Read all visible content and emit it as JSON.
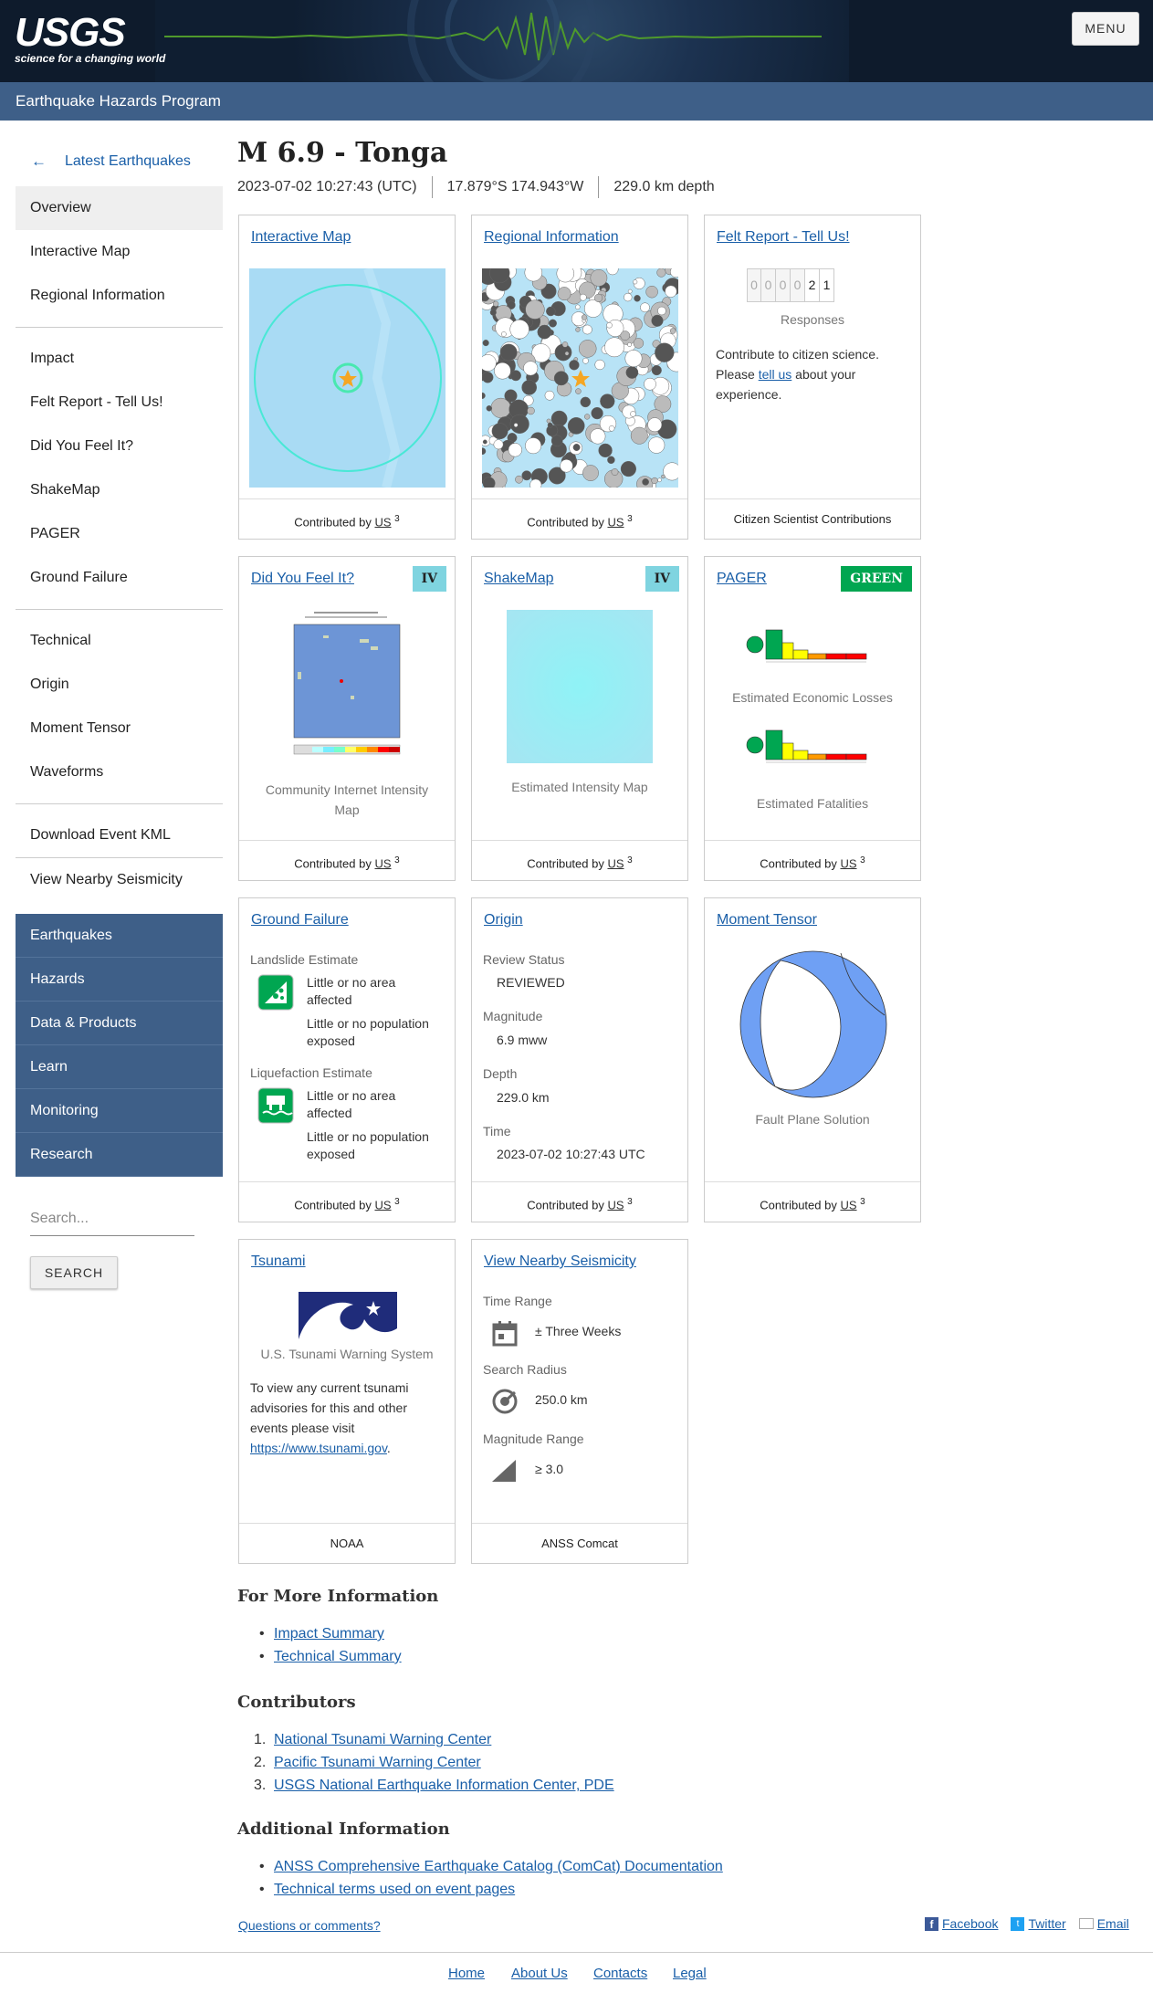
{
  "header": {
    "logo": "USGS",
    "tagline": "science for a changing world",
    "menu_label": "MENU",
    "program": "Earthquake Hazards Program"
  },
  "sidebar": {
    "back_label": "Latest Earthquakes",
    "groups": [
      [
        "Overview",
        "Interactive Map",
        "Regional Information"
      ],
      [
        "Impact",
        "Felt Report - Tell Us!",
        "Did You Feel It?",
        "ShakeMap",
        "PAGER",
        "Ground Failure"
      ],
      [
        "Technical",
        "Origin",
        "Moment Tensor",
        "Waveforms"
      ],
      [
        "Download Event KML"
      ],
      [
        "View Nearby Seismicity"
      ]
    ],
    "site_nav": [
      "Earthquakes",
      "Hazards",
      "Data & Products",
      "Learn",
      "Monitoring",
      "Research"
    ],
    "search_placeholder": "Search...",
    "search_button": "SEARCH"
  },
  "event": {
    "title": "M 6.9 - Tonga",
    "time": "2023-07-02 10:27:43 (UTC)",
    "location": "17.879°S 174.943°W",
    "depth": "229.0 km depth"
  },
  "cards": {
    "interactive_map": {
      "title": "Interactive Map",
      "footer": "Contributed by",
      "net": "US",
      "sup": "3"
    },
    "regional": {
      "title": "Regional Information",
      "footer": "Contributed by",
      "net": "US",
      "sup": "3"
    },
    "felt_report": {
      "title": "Felt Report - Tell Us!",
      "digits": [
        "0",
        "0",
        "0",
        "0",
        "2",
        "1"
      ],
      "responses_label": "Responses",
      "text_before": "Contribute to citizen science. Please ",
      "link": "tell us",
      "text_after": " about your experience.",
      "footer": "Citizen Scientist Contributions"
    },
    "dyfi": {
      "title": "Did You Feel It?",
      "badge": "IV",
      "caption": "Community Internet Intensity Map",
      "footer": "Contributed by",
      "net": "US",
      "sup": "3"
    },
    "shakemap": {
      "title": "ShakeMap",
      "badge": "IV",
      "caption": "Estimated Intensity Map",
      "footer": "Contributed by",
      "net": "US",
      "sup": "3"
    },
    "pager": {
      "title": "PAGER",
      "badge": "GREEN",
      "economic": "Estimated Economic Losses",
      "fatalities": "Estimated Fatalities",
      "footer": "Contributed by",
      "net": "US",
      "sup": "3"
    },
    "ground_failure": {
      "title": "Ground Failure",
      "landslide_label": "Landslide Estimate",
      "landslide_area": "Little or no area affected",
      "landslide_pop": "Little or no population exposed",
      "liquefaction_label": "Liquefaction Estimate",
      "liquefaction_area": "Little or no area affected",
      "liquefaction_pop": "Little or no population exposed",
      "footer": "Contributed by",
      "net": "US",
      "sup": "3"
    },
    "origin": {
      "title": "Origin",
      "review_label": "Review Status",
      "review": "REVIEWED",
      "magnitude_label": "Magnitude",
      "magnitude": "6.9 mww",
      "depth_label": "Depth",
      "depth": "229.0 km",
      "time_label": "Time",
      "time": "2023-07-02 10:27:43 UTC",
      "footer": "Contributed by",
      "net": "US",
      "sup": "3"
    },
    "moment_tensor": {
      "title": "Moment Tensor",
      "caption": "Fault Plane Solution",
      "footer": "Contributed by",
      "net": "US",
      "sup": "3"
    },
    "tsunami": {
      "title": "Tsunami",
      "caption": "U.S. Tsunami Warning System",
      "text": "To view any current tsunami advisories for this and other events please visit ",
      "link": "https://www.tsunami.gov",
      "footer": "NOAA"
    },
    "nearby": {
      "title": "View Nearby Seismicity",
      "time_label": "Time Range",
      "time": "± Three Weeks",
      "radius_label": "Search Radius",
      "radius": "250.0 km",
      "mag_label": "Magnitude Range",
      "mag": "≥ 3.0",
      "footer": "ANSS Comcat"
    }
  },
  "more_info": {
    "heading": "For More Information",
    "links": [
      "Impact Summary",
      "Technical Summary"
    ]
  },
  "contributors": {
    "heading": "Contributors",
    "links": [
      "National Tsunami Warning Center",
      "Pacific Tsunami Warning Center",
      "USGS National Earthquake Information Center, PDE"
    ]
  },
  "additional": {
    "heading": "Additional Information",
    "links": [
      "ANSS Comprehensive Earthquake Catalog (ComCat) Documentation",
      "Technical terms used on event pages"
    ]
  },
  "feedback": {
    "questions": "Questions or comments?",
    "facebook": "Facebook",
    "twitter": "Twitter",
    "email": "Email"
  },
  "footer": [
    "Home",
    "About Us",
    "Contacts",
    "Legal"
  ],
  "colors": {
    "nav_blue": "#3e5f88",
    "link": "#1a5fa8",
    "intensity_iv": "#7fd4e0",
    "pager_green": "#00a651"
  }
}
